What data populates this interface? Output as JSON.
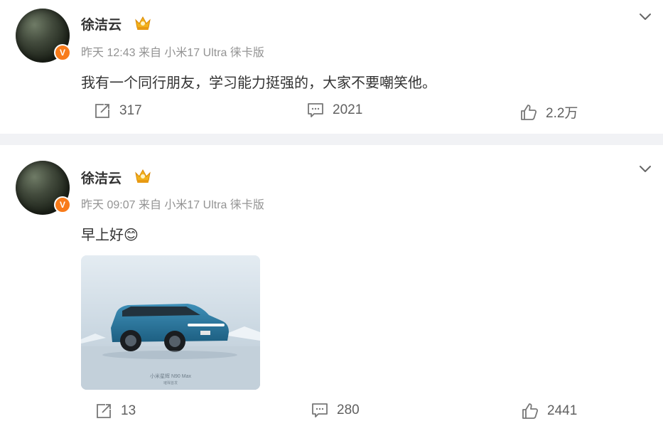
{
  "posts": [
    {
      "username": "徐洁云",
      "time": "昨天 12:43",
      "source": "来自 小米17 Ultra 徕卡版",
      "content": "我有一个同行朋友，学习能力挺强的，大家不要嘲笑他。",
      "repost_count": "317",
      "comment_count": "2021",
      "like_count": "2.2万"
    },
    {
      "username": "徐洁云",
      "time": "昨天 09:07",
      "source": "来自 小米17 Ultra 徕卡版",
      "content": "早上好😊",
      "image_caption": "小米星辉 N90 Max",
      "image_subcaption": "璀璨首发",
      "repost_count": "13",
      "comment_count": "280",
      "like_count": "2441"
    }
  ],
  "colors": {
    "verified_badge": "#f87b1a",
    "meta_text": "#939393",
    "separator": "#f1f2f5"
  },
  "icons": {
    "verified": "V",
    "more": "chevron-down-icon",
    "repost": "repost-icon",
    "comment": "comment-icon",
    "like": "thumbs-up-icon",
    "crown": "crown-badge-icon"
  }
}
